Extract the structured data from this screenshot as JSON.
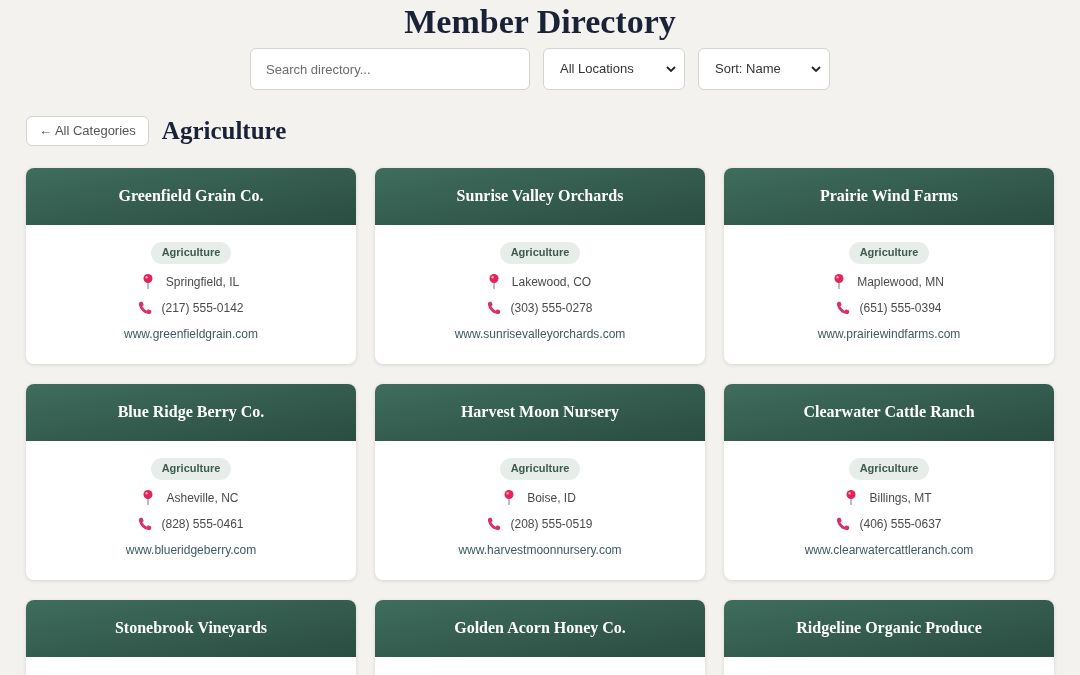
{
  "page": {
    "title": "Member Directory"
  },
  "filters": {
    "search": {
      "placeholder": "Search directory..."
    },
    "location": {
      "value": "All Locations"
    },
    "sort": {
      "value": "Sort: Name"
    }
  },
  "category": {
    "back_button": "← All Categories",
    "title": "Agriculture"
  },
  "members": [
    {
      "name": "Greenfield Grain Co.",
      "category": "Agriculture",
      "location": "Springfield, IL",
      "phone": "(217) 555-0142",
      "website": "www.greenfieldgrain.com"
    },
    {
      "name": "Sunrise Valley Orchards",
      "category": "Agriculture",
      "location": "Lakewood, CO",
      "phone": "(303) 555-0278",
      "website": "www.sunrisevalleyorchards.com"
    },
    {
      "name": "Prairie Wind Farms",
      "category": "Agriculture",
      "location": "Maplewood, MN",
      "phone": "(651) 555-0394",
      "website": "www.prairiewindfarms.com"
    },
    {
      "name": "Blue Ridge Berry Co.",
      "category": "Agriculture",
      "location": "Asheville, NC",
      "phone": "(828) 555-0461",
      "website": "www.blueridgeberry.com"
    },
    {
      "name": "Harvest Moon Nursery",
      "category": "Agriculture",
      "location": "Boise, ID",
      "phone": "(208) 555-0519",
      "website": "www.harvestmoonnursery.com"
    },
    {
      "name": "Clearwater Cattle Ranch",
      "category": "Agriculture",
      "location": "Billings, MT",
      "phone": "(406) 555-0637",
      "website": "www.clearwatercattleranch.com"
    },
    {
      "name": "Stonebrook Vineyards"
    },
    {
      "name": "Golden Acorn Honey Co."
    },
    {
      "name": "Ridgeline Organic Produce"
    }
  ]
}
